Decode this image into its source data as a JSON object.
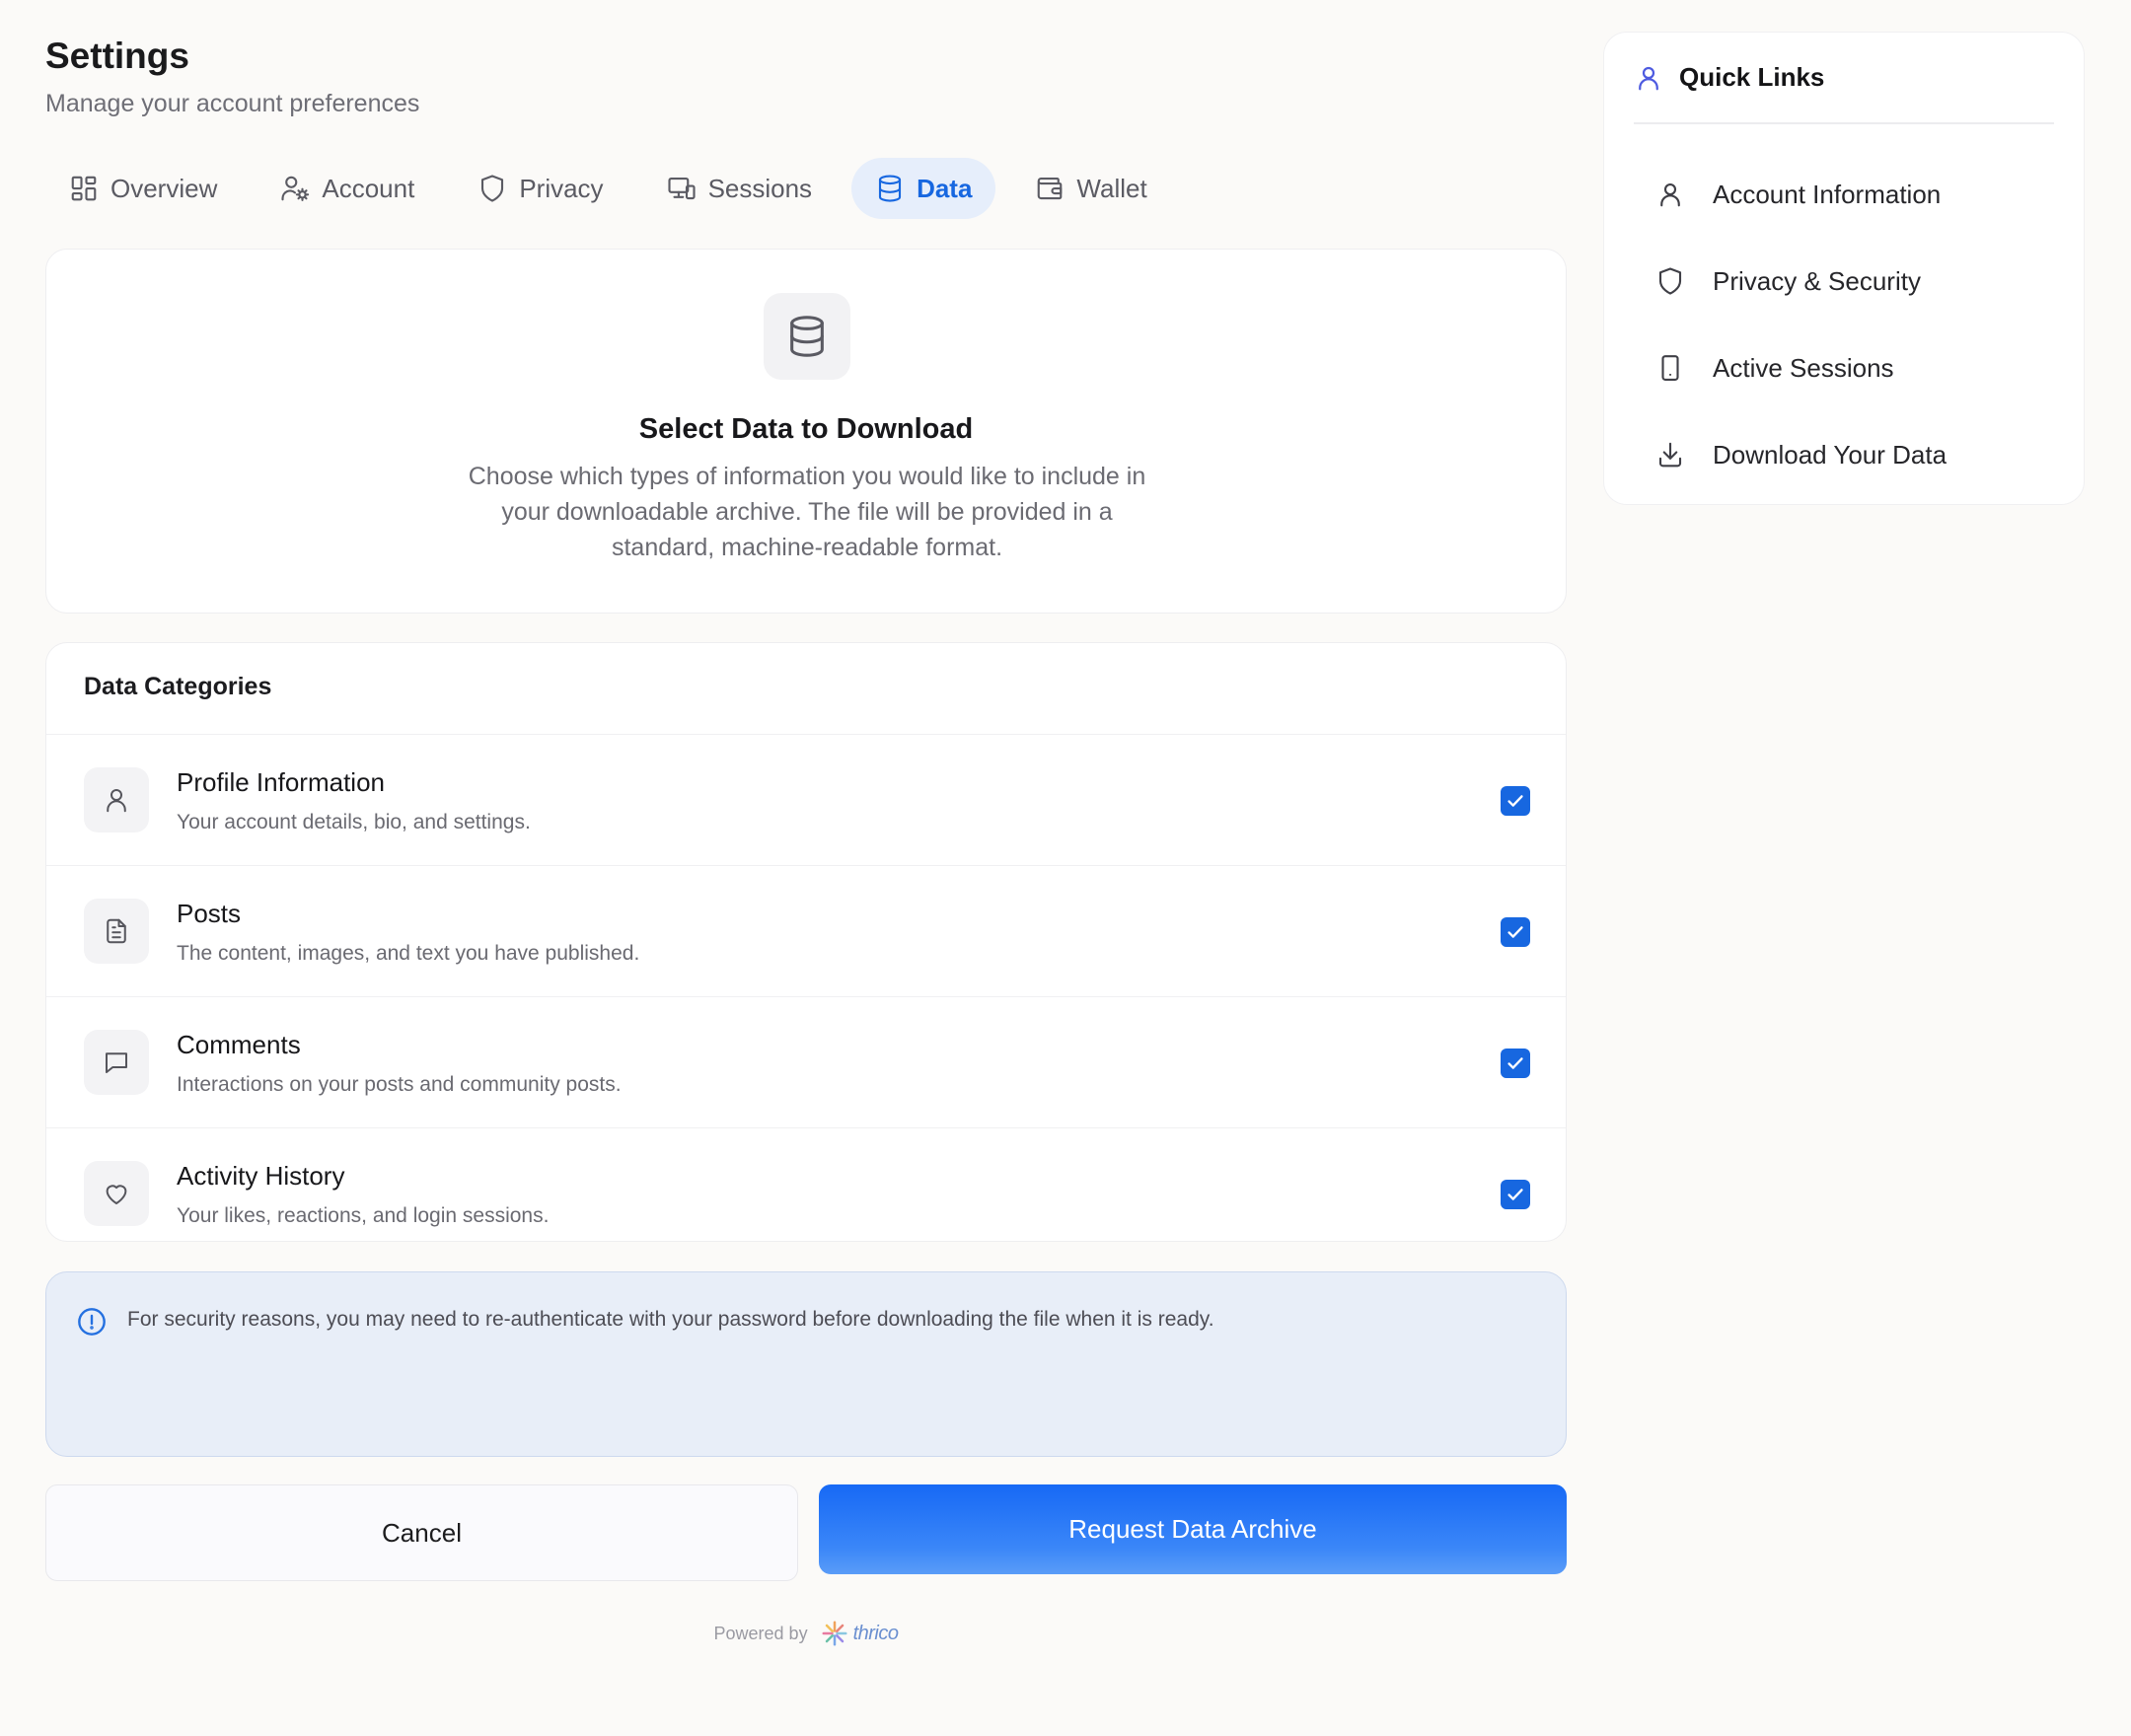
{
  "header": {
    "title": "Settings",
    "subtitle": "Manage your account preferences"
  },
  "tabs": [
    {
      "label": "Overview",
      "icon": "grid-icon",
      "active": false
    },
    {
      "label": "Account",
      "icon": "user-cog-icon",
      "active": false
    },
    {
      "label": "Privacy",
      "icon": "shield-icon",
      "active": false
    },
    {
      "label": "Sessions",
      "icon": "devices-icon",
      "active": false
    },
    {
      "label": "Data",
      "icon": "database-icon",
      "active": true
    },
    {
      "label": "Wallet",
      "icon": "wallet-icon",
      "active": false
    }
  ],
  "hero": {
    "icon": "database-icon",
    "title": "Select Data to Download",
    "description": "Choose which types of information you would like to include in your downloadable archive. The file will be provided in a standard, machine-readable format."
  },
  "categories": {
    "title": "Data Categories",
    "items": [
      {
        "name": "Profile Information",
        "description": "Your account details, bio, and settings.",
        "icon": "user-icon",
        "checked": true
      },
      {
        "name": "Posts",
        "description": "The content, images, and text you have published.",
        "icon": "document-icon",
        "checked": true
      },
      {
        "name": "Comments",
        "description": "Interactions on your posts and community posts.",
        "icon": "chat-icon",
        "checked": true
      },
      {
        "name": "Activity History",
        "description": "Your likes, reactions, and login sessions.",
        "icon": "heart-icon",
        "checked": true
      }
    ]
  },
  "notice": {
    "icon": "info-icon",
    "text": "For security reasons, you may need to re-authenticate with your password before downloading the file when it is ready."
  },
  "actions": {
    "cancel_label": "Cancel",
    "submit_label": "Request Data Archive"
  },
  "footer": {
    "powered_by": "Powered by",
    "brand": "thrico"
  },
  "quick_links": {
    "title": "Quick Links",
    "items": [
      {
        "label": "Account Information",
        "icon": "user-icon"
      },
      {
        "label": "Privacy & Security",
        "icon": "shield-icon"
      },
      {
        "label": "Active Sessions",
        "icon": "phone-icon"
      },
      {
        "label": "Download Your Data",
        "icon": "download-icon"
      }
    ]
  },
  "colors": {
    "accent": "#1767e0",
    "background": "#fbfaf8",
    "notice_bg": "#e8eef8"
  }
}
